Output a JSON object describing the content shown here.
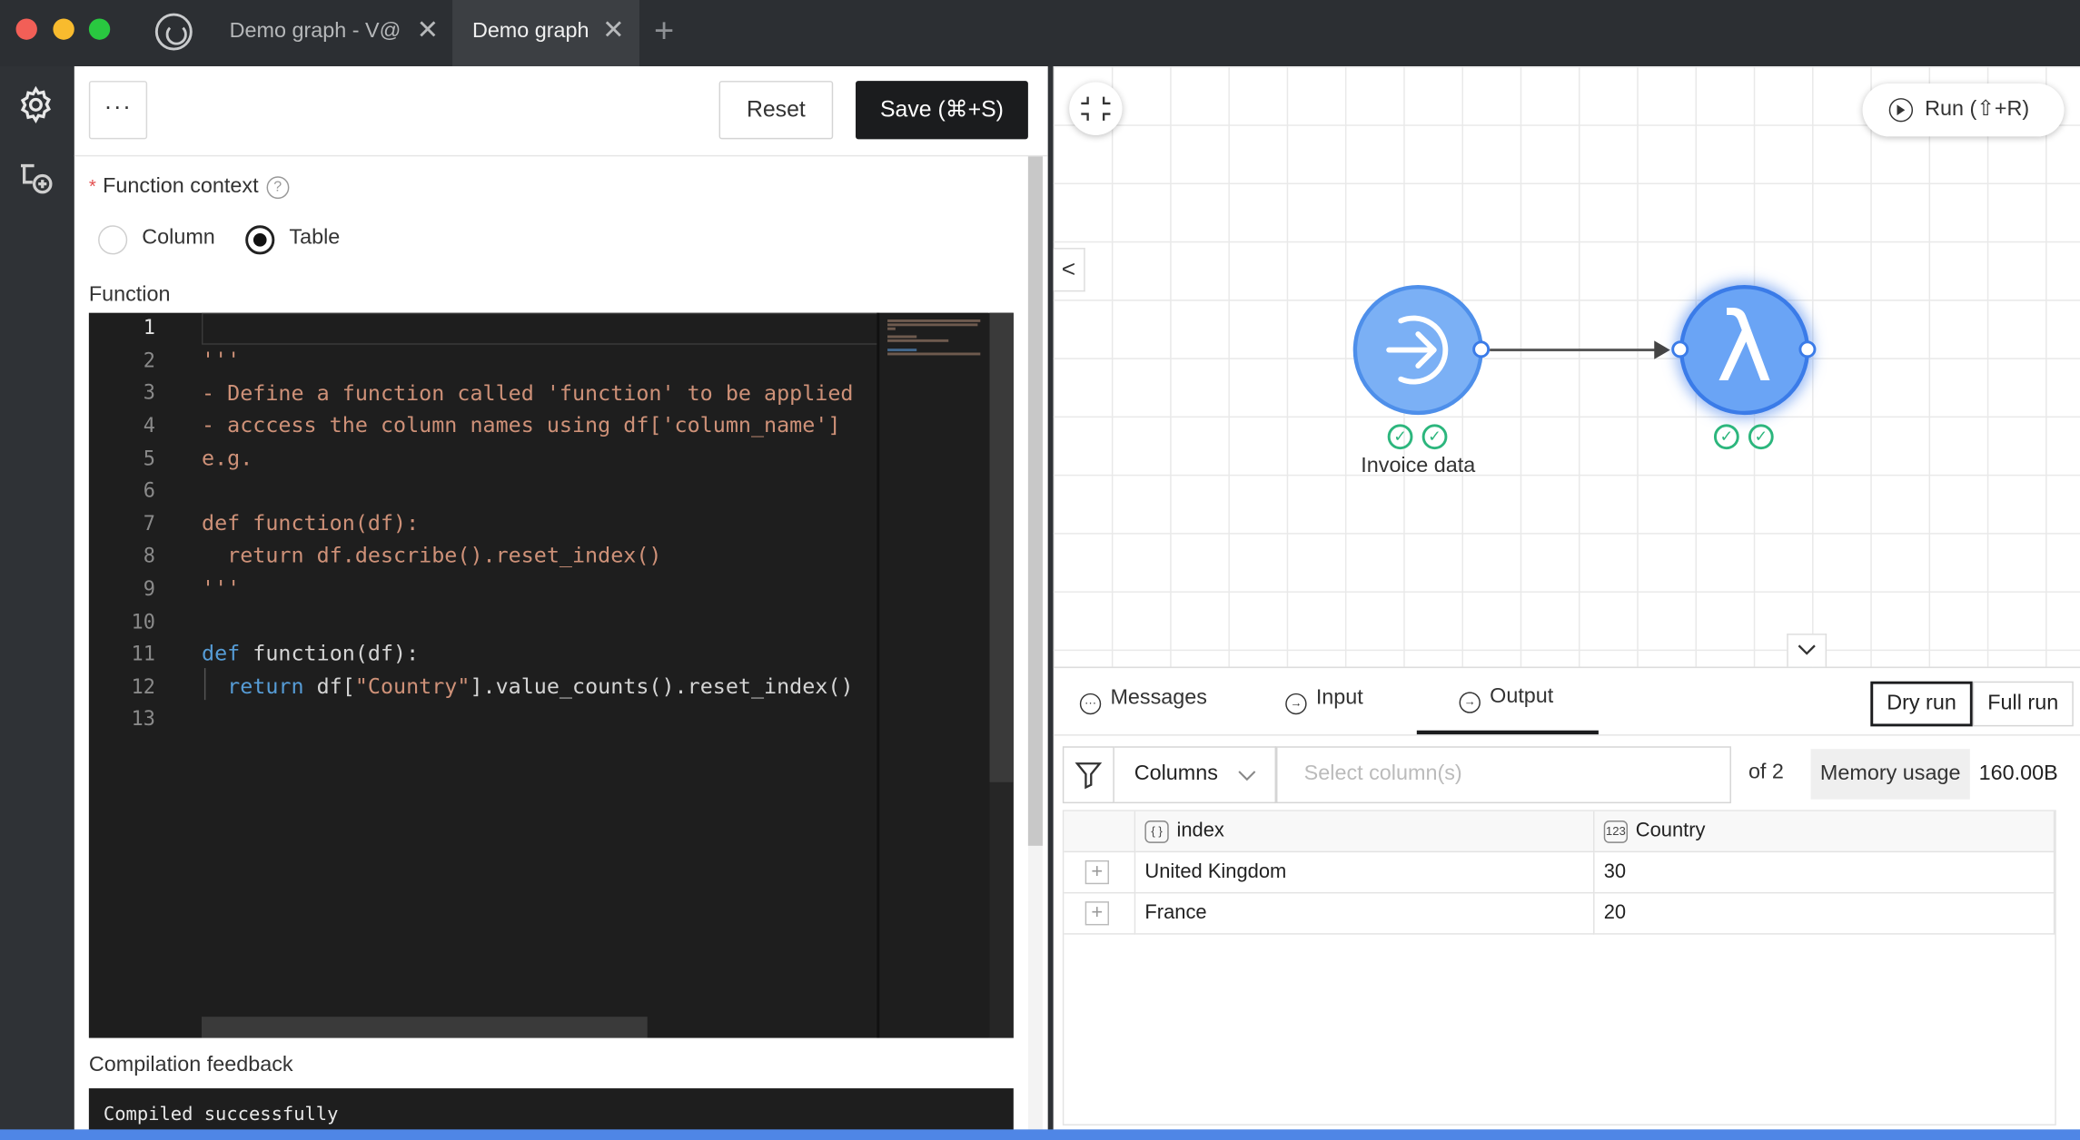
{
  "titlebar": {
    "tabs": [
      {
        "label": "Demo graph - V@",
        "active": false
      },
      {
        "label": "Demo graph",
        "active": true
      }
    ],
    "close_glyph": "✕",
    "add_glyph": "+"
  },
  "rail": {
    "icons": [
      "gear-icon",
      "add-node-icon"
    ]
  },
  "toolbar": {
    "more_label": "···",
    "reset_label": "Reset",
    "save_label": "Save (⌘+S)"
  },
  "form": {
    "context_label": "Function context",
    "required_mark": "*",
    "help_glyph": "?",
    "radio_options": [
      {
        "label": "Column",
        "checked": false
      },
      {
        "label": "Table",
        "checked": true
      }
    ],
    "function_label": "Function",
    "compilation_label": "Compilation feedback",
    "compilation_text": "Compiled successfully"
  },
  "editor": {
    "language": "python",
    "active_line": 1,
    "line_numbers": [
      "1",
      "2",
      "3",
      "4",
      "5",
      "6",
      "7",
      "8",
      "9",
      "10",
      "11",
      "12",
      "13"
    ],
    "lines": [
      "",
      "'''",
      "- Define a function called 'function' to be applied",
      "- acccess the column names using df['column_name']",
      "e.g.",
      "",
      "def function(df):",
      "  return df.describe().reset_index()",
      "'''",
      "",
      "def function(df):",
      "  return df[\"Country\"].value_counts().reset_index()",
      ""
    ],
    "code_tokens": {
      "def_kw": "def",
      "def_rest": " function(df):",
      "return_kw": "return",
      "return_pre": " df[",
      "return_str": "\"Country\"",
      "return_post": "].value_counts().reset_index()"
    }
  },
  "graph": {
    "run_label": "Run (⇧+R)",
    "collapse_left_glyph": "<",
    "nodes": [
      {
        "label": "Invoice data",
        "type": "input",
        "checks": 2
      },
      {
        "label": "",
        "type": "function",
        "glyph": "λ",
        "checks": 2
      }
    ],
    "check_glyph": "✓",
    "colors": {
      "node_input": "#7bb0f5",
      "node_function": "#6aa4f5",
      "edge": "#555555",
      "status_ok": "#2cb67d"
    }
  },
  "bottom": {
    "tabs": [
      {
        "label": "Messages",
        "icon": "chat-icon",
        "active": false
      },
      {
        "label": "Input",
        "icon": "input-icon",
        "active": false
      },
      {
        "label": "Output",
        "icon": "output-icon",
        "active": true
      }
    ],
    "dry_run_label": "Dry run",
    "full_run_label": "Full run",
    "columns_label": "Columns",
    "column_select_placeholder": "Select column(s)",
    "of_text": "of 2",
    "memory_label": "Memory usage",
    "memory_value": "160.00B",
    "table": {
      "columns": [
        {
          "name": "index",
          "type_badge": "{ }"
        },
        {
          "name": "Country",
          "type_badge": "123"
        }
      ],
      "rows": [
        [
          "United Kingdom",
          "30"
        ],
        [
          "France",
          "20"
        ]
      ],
      "expand_glyph": "+"
    }
  }
}
